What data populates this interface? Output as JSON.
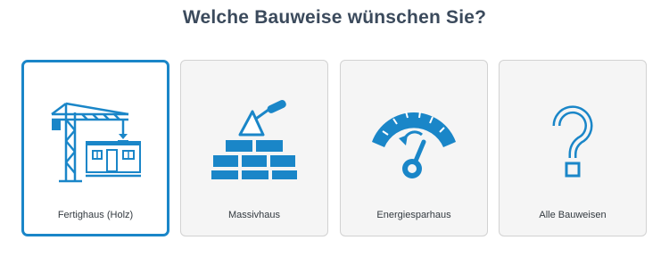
{
  "page": {
    "title": "Welche Bauweise wünschen Sie?"
  },
  "options": [
    {
      "label": "Fertighaus (Holz)",
      "icon": "crane-house-icon",
      "selected": true
    },
    {
      "label": "Massivhaus",
      "icon": "bricks-trowel-icon",
      "selected": false
    },
    {
      "label": "Energiesparhaus",
      "icon": "gauge-icon",
      "selected": false
    },
    {
      "label": "Alle Bauweisen",
      "icon": "question-mark-icon",
      "selected": false
    }
  ],
  "colors": {
    "accent": "#1a86c8",
    "title": "#3b4a5c",
    "card_bg": "#f5f5f5",
    "card_border": "#d2d2d2"
  }
}
